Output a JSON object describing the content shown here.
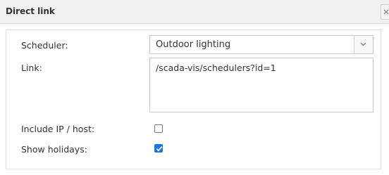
{
  "dialog": {
    "title": "Direct link"
  },
  "form": {
    "scheduler_label": "Scheduler:",
    "scheduler_value": "Outdoor lighting",
    "link_label": "Link:",
    "link_value": "/scada-vis/schedulers?id=1",
    "include_ip_label": "Include IP / host:",
    "include_ip_checked": false,
    "show_holidays_label": "Show holidays:",
    "show_holidays_checked": true
  },
  "colors": {
    "titlebar_bg": "#f1f1f1",
    "checkbox_checked": "#1a73e8",
    "text": "#333333"
  }
}
